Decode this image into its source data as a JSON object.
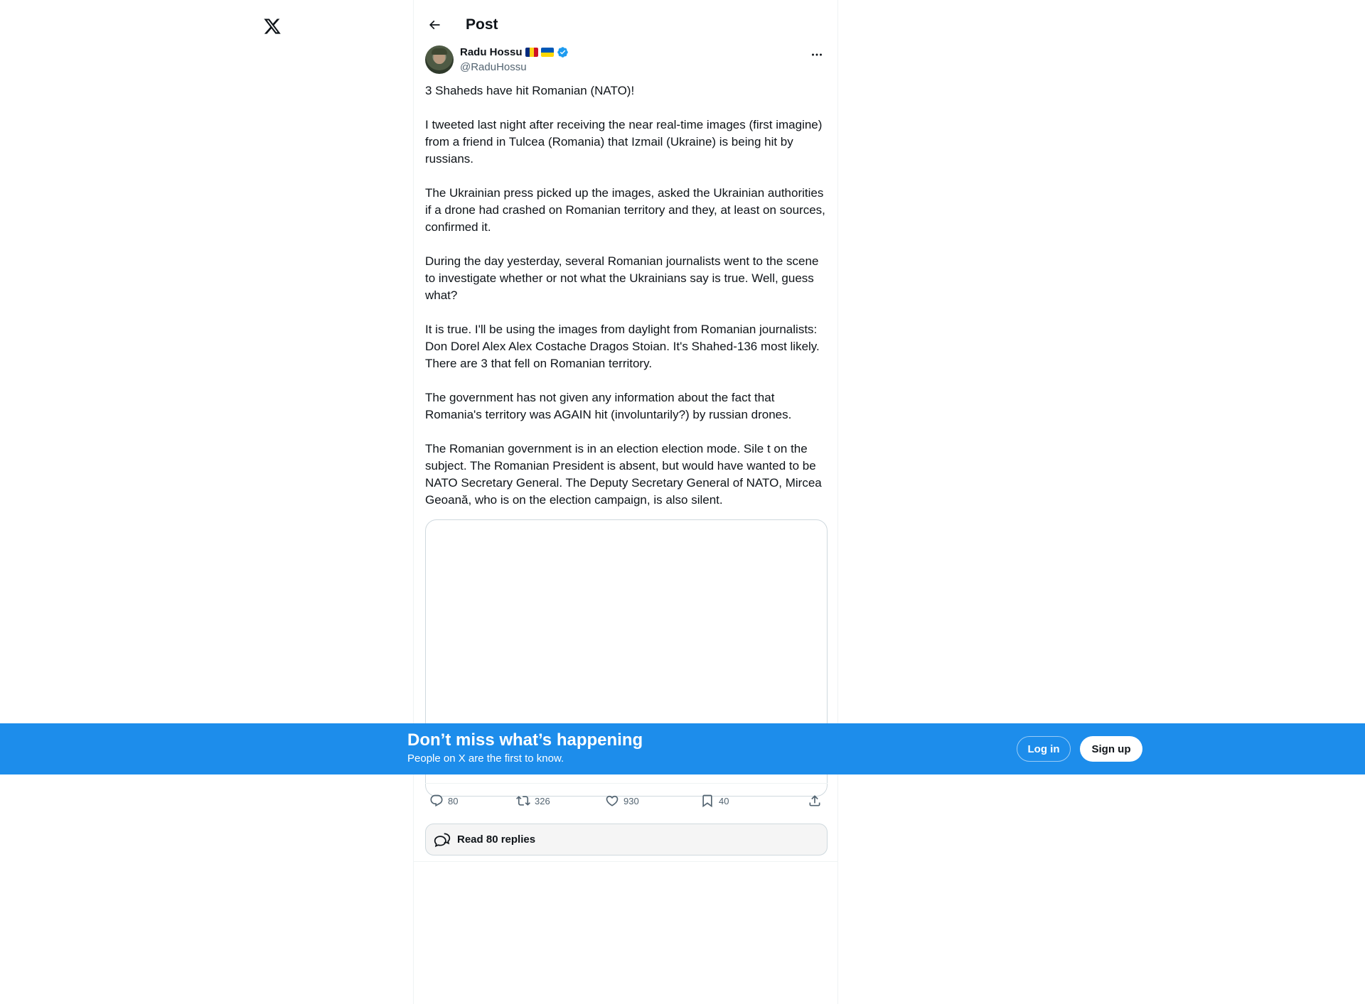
{
  "nav": {
    "logo_icon": "x-logo-icon"
  },
  "header": {
    "title": "Post",
    "back_icon": "arrow-left-icon"
  },
  "post": {
    "author_name": "Radu Hossu",
    "author_handle": "@RaduHossu",
    "flags": [
      "romania-flag",
      "ukraine-flag"
    ],
    "verified": true,
    "more_icon": "more-horizontal-icon",
    "paragraphs": [
      "3 Shaheds have hit Romanian (NATO)!",
      "I tweeted last night after receiving the near real-time images (first imagine) from a friend in Tulcea (Romania) that Izmail (Ukraine) is being hit by russians.",
      "The Ukrainian press picked up the images, asked the Ukrainian authorities if a drone had crashed on Romanian territory and they, at least on sources, confirmed it.",
      "During the day yesterday, several Romanian journalists went to the scene to investigate whether or not what the Ukrainians say is true. Well, guess what?",
      "It is true. I'll be using the images from daylight from Romanian journalists: Don Dorel Alex Alex Costache Dragos Stoian. It's Shahed-136 most likely. There are 3 that fell on Romanian territory.",
      "The government has not given any information about the fact that Romania's territory was AGAIN hit (involuntarily?) by russian drones.",
      "The Romanian government is in an election election mode. Sile t on the subject. The Romanian President is absent, but would have wanted to be NATO Secretary General. The Deputy Secretary General of NATO, Mircea Geoană, who is on the election campaign, is also silent."
    ],
    "stats": {
      "replies": "80",
      "reposts": "326",
      "likes": "930",
      "bookmarks": "40"
    },
    "read_replies_label": "Read 80 replies"
  },
  "banner": {
    "title": "Don’t miss what’s happening",
    "subtitle": "People on X are the first to know.",
    "login_label": "Log in",
    "signup_label": "Sign up"
  },
  "colors": {
    "banner_bg": "#1d8deb",
    "verified": "#1d9bf0",
    "text_primary": "#0f1419",
    "text_secondary": "#536471"
  }
}
